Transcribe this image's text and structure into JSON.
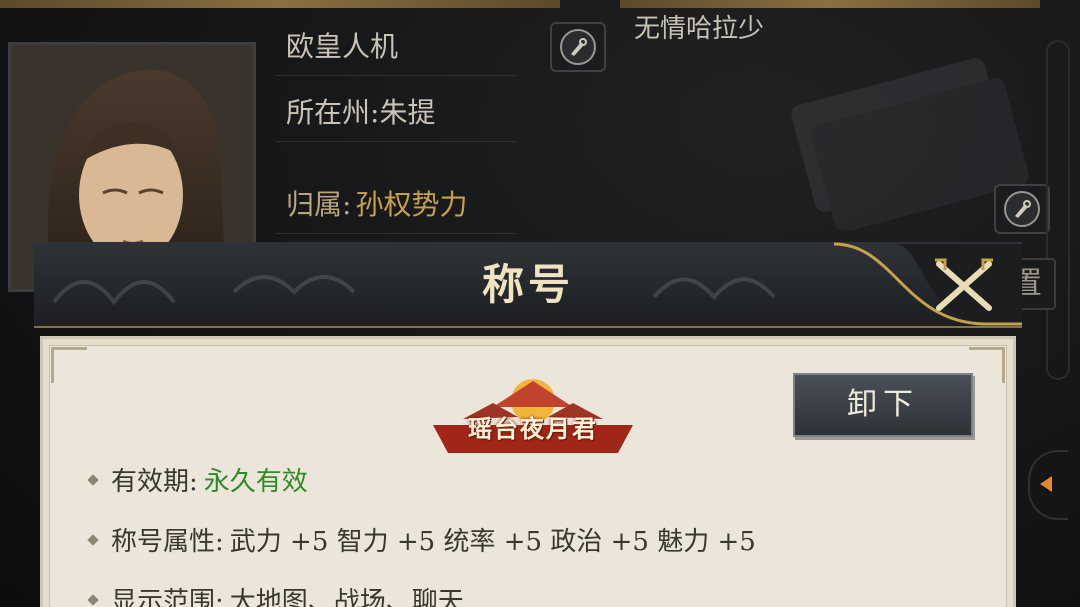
{
  "profile": {
    "player_name": "欧皇人机",
    "state_label": "所在州:",
    "state_value": "朱提",
    "faction_label": "归属:",
    "faction_value": "孙权势力",
    "signature": "无情哈拉少",
    "side_button_char": "置"
  },
  "modal": {
    "title": "称号",
    "unequip_label": "卸下",
    "emblem_text": "瑶台夜月君",
    "validity_label": "有效期:",
    "validity_value": "永久有效",
    "attributes_label": "称号属性:",
    "attributes_value": "武力 +5 智力 +5 统率 +5 政治 +5 魅力 +5",
    "display_label": "显示范围:",
    "display_value": "大地图、战场、聊天"
  },
  "colors": {
    "gold_accent": "#c7a14a",
    "valid_green": "#2f8a2a",
    "parchment": "#ece6da"
  },
  "icons": {
    "edit": "brush-edit-icon",
    "close": "crossed-swords-close-icon",
    "side_arrow": "arrow-left-icon"
  }
}
